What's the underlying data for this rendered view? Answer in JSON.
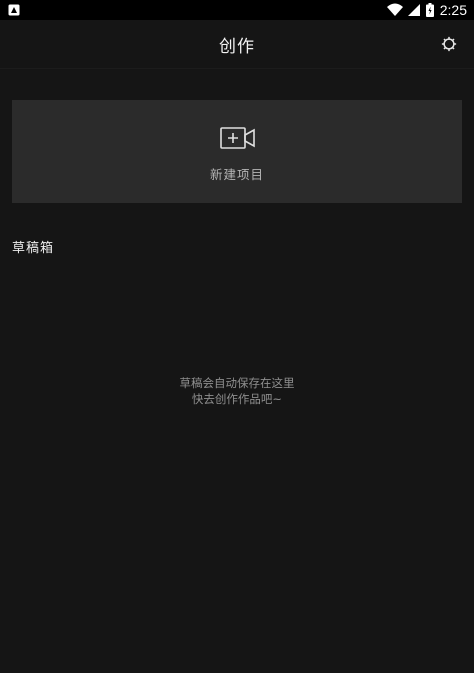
{
  "status_bar": {
    "time": "2:25",
    "icons": [
      "notification-icon",
      "wifi-icon",
      "signal-icon",
      "battery-icon"
    ]
  },
  "app_bar": {
    "title": "创作",
    "settings_icon": "gear-icon"
  },
  "new_project": {
    "label": "新建项目",
    "icon": "add-video-icon"
  },
  "drafts": {
    "title": "草稿箱",
    "empty_line1": "草稿会自动保存在这里",
    "empty_line2": "快去创作作品吧~"
  },
  "colors": {
    "background": "#151515",
    "card": "#2b2b2b",
    "status_bar": "#000000",
    "primary_text": "#f2f2f2",
    "secondary_text": "#8f8f8f"
  }
}
